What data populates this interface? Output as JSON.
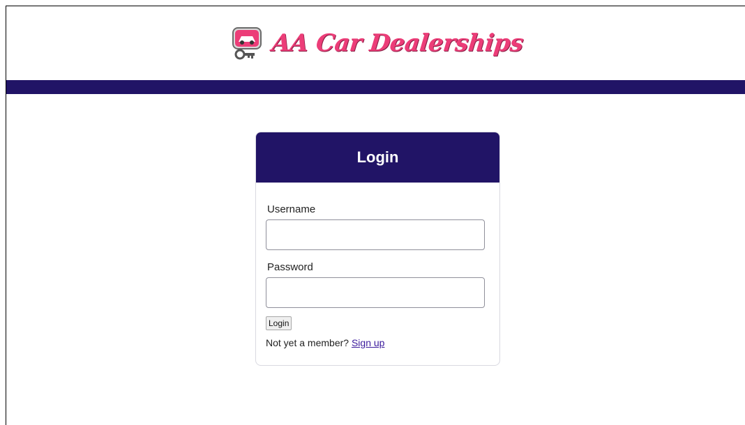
{
  "header": {
    "brand_name": "AA Car Dealerships",
    "logo_icon": "car-key-icon",
    "brand_color": "#ec3d78"
  },
  "navbar": {
    "color": "#211466"
  },
  "login": {
    "title": "Login",
    "username_label": "Username",
    "username_value": "",
    "password_label": "Password",
    "password_value": "",
    "submit_label": "Login",
    "signup_prompt": "Not yet a member?",
    "signup_link": "Sign up"
  }
}
